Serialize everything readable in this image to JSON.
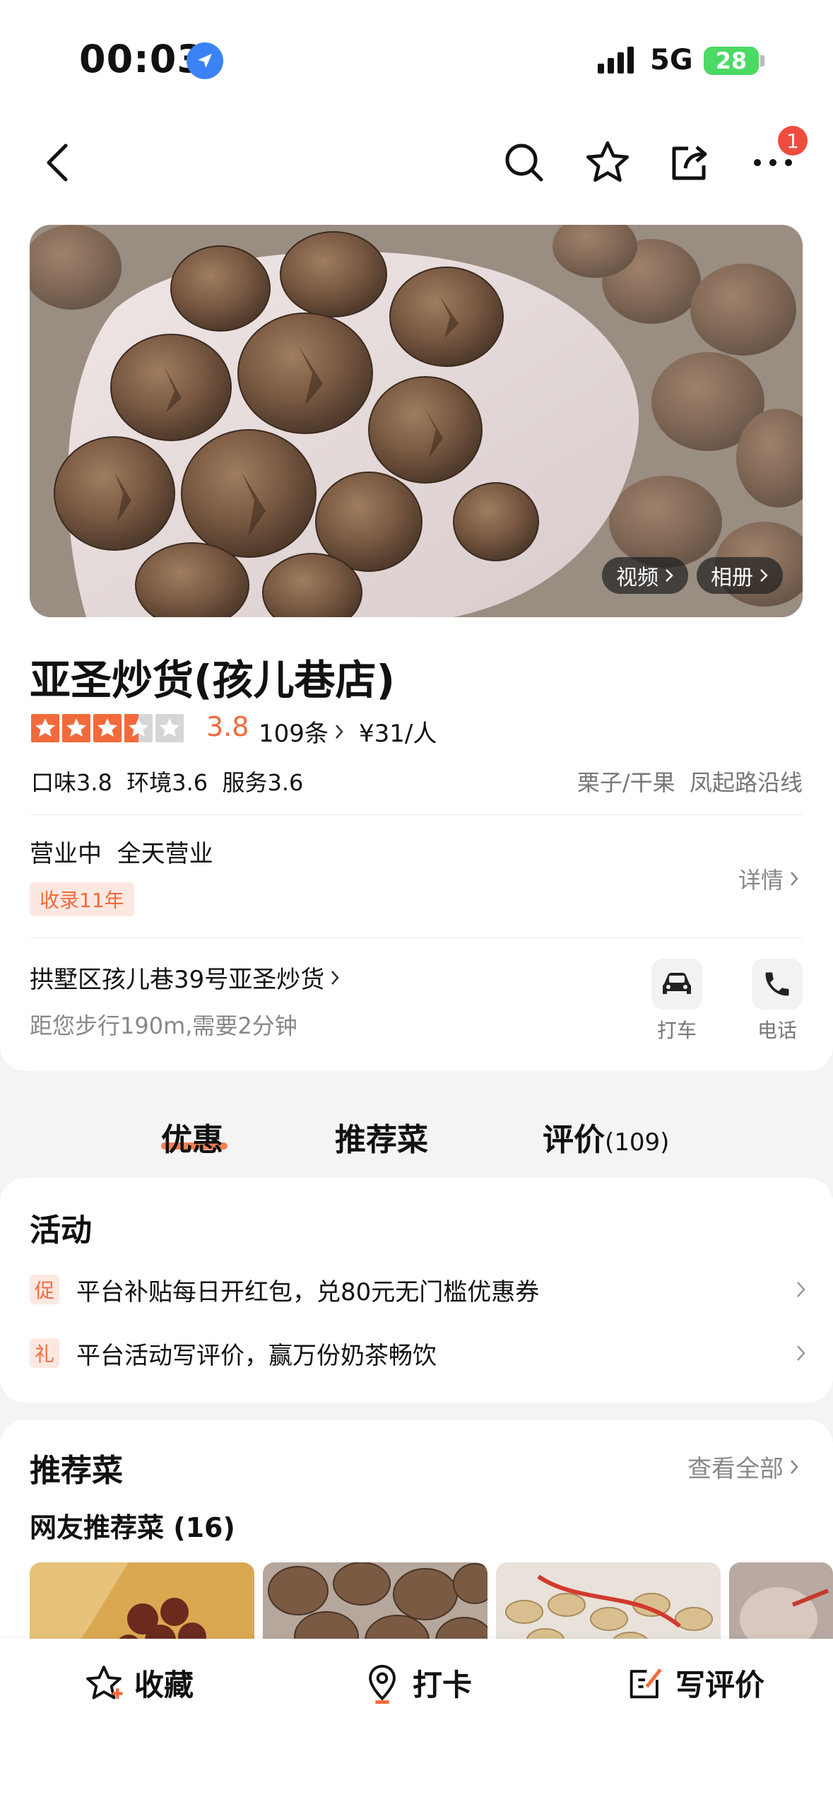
{
  "status": {
    "time": "00:03",
    "network": "5G",
    "battery": "28"
  },
  "nav": {
    "badge_count": "1"
  },
  "hero": {
    "video_label": "视频",
    "album_label": "相册"
  },
  "shop": {
    "name": "亚圣炒货(孩儿巷店)",
    "rating": "3.8",
    "rating_stars": 3.5,
    "review_count": "109条",
    "price": "¥31/人",
    "subscores": "口味3.8  环境3.6  服务3.6",
    "categories": "栗子/干果  凤起路沿线",
    "hours": "营业中  全天营业",
    "tag": "收录11年",
    "detail": "详情",
    "address": "拱墅区孩儿巷39号亚圣炒货",
    "walk": "距您步行190m,需要2分钟",
    "taxi_label": "打车",
    "phone_label": "电话"
  },
  "tabs": {
    "deals": "优惠",
    "dishes": "推荐菜",
    "reviews": "评价",
    "reviews_count": "(109)"
  },
  "activities": {
    "title": "活动",
    "items": [
      {
        "icon": "促",
        "text": "平台补贴每日开红包，兑80元无门槛优惠券"
      },
      {
        "icon": "礼",
        "text": "平台活动写评价，赢万份奶茶畅饮"
      }
    ]
  },
  "recommended": {
    "title": "推荐菜",
    "view_all": "查看全部",
    "subtitle": "网友推荐菜 (16)"
  },
  "bottom_bar": {
    "favorite": "收藏",
    "checkin": "打卡",
    "write_review": "写评价"
  },
  "colors": {
    "accent": "#f26a3b",
    "badge": "#f04c3e"
  }
}
